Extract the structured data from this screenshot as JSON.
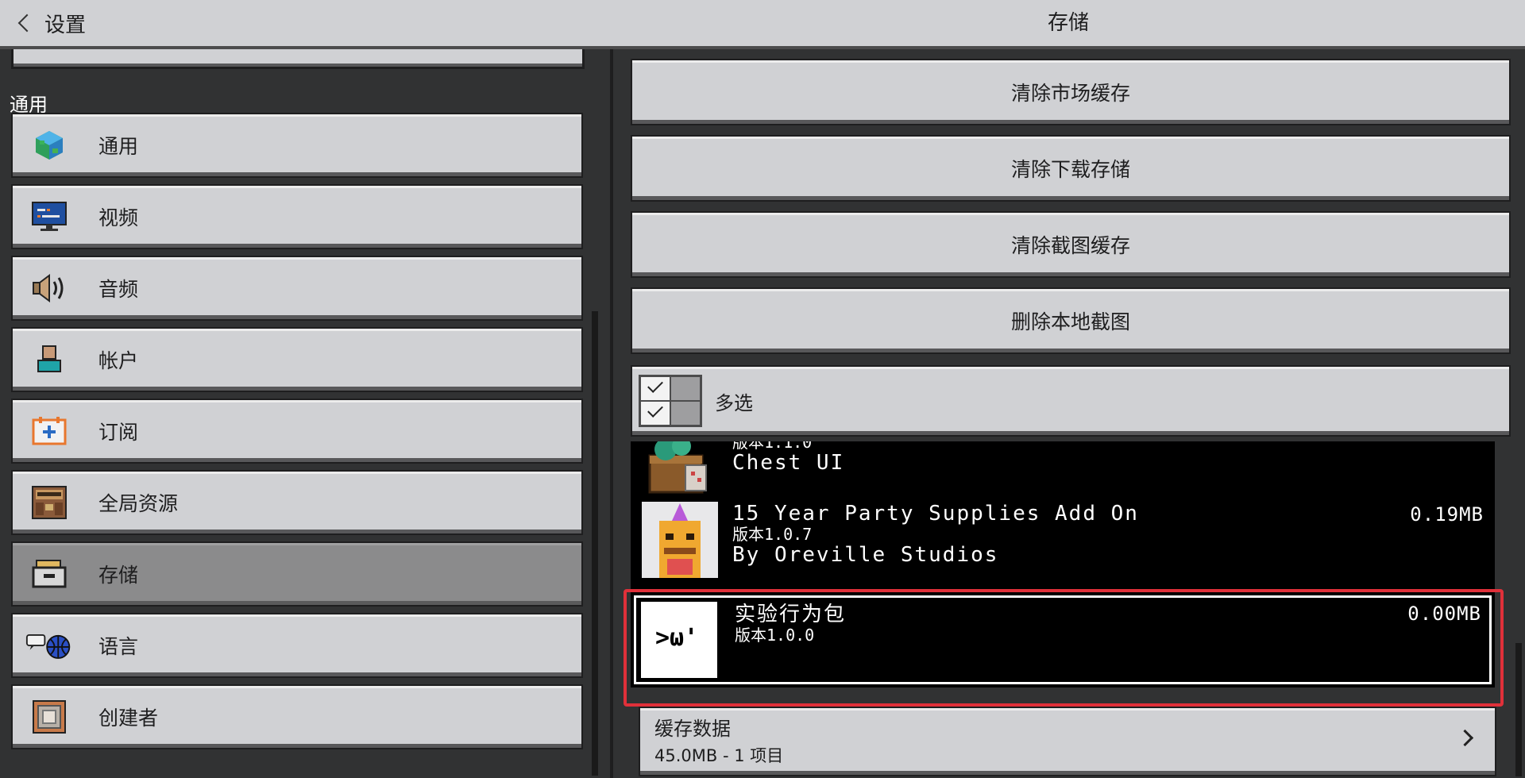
{
  "header": {
    "back_label": "设置",
    "title": "存储"
  },
  "sidebar": {
    "section_label": "通用",
    "items": [
      {
        "label": "通用",
        "icon": "globe-icon"
      },
      {
        "label": "视频",
        "icon": "monitor-icon"
      },
      {
        "label": "音频",
        "icon": "speaker-icon"
      },
      {
        "label": "帐户",
        "icon": "account-icon"
      },
      {
        "label": "订阅",
        "icon": "calendar-plus-icon"
      },
      {
        "label": "全局资源",
        "icon": "resource-pack-icon"
      },
      {
        "label": "存储",
        "icon": "folder-drawer-icon",
        "selected": true
      },
      {
        "label": "语言",
        "icon": "language-icon"
      },
      {
        "label": "创建者",
        "icon": "command-block-icon"
      }
    ]
  },
  "main": {
    "buttons": [
      "清除市场缓存",
      "清除下载存储",
      "清除截图缓存",
      "删除本地截图"
    ],
    "multi_select_label": "多选",
    "packs": [
      {
        "version": "版本1.1.0",
        "name": "Chest UI",
        "size": ""
      },
      {
        "name": "15 Year Party Supplies Add On",
        "version": "版本1.0.7",
        "author": "By Oreville Studios",
        "size": "0.19MB"
      },
      {
        "name": "实验行为包",
        "version": "版本1.0.0",
        "size": "0.00MB",
        "selected": true,
        "thumb_text": ">ω'"
      }
    ],
    "cache": {
      "title": "缓存数据",
      "subtitle": "45.0MB - 1 项目"
    }
  },
  "colors": {
    "button_gray": "#d0d1d4",
    "selected_gray": "#8b8b8c",
    "background": "#313233",
    "highlight_red": "#e0303a"
  }
}
